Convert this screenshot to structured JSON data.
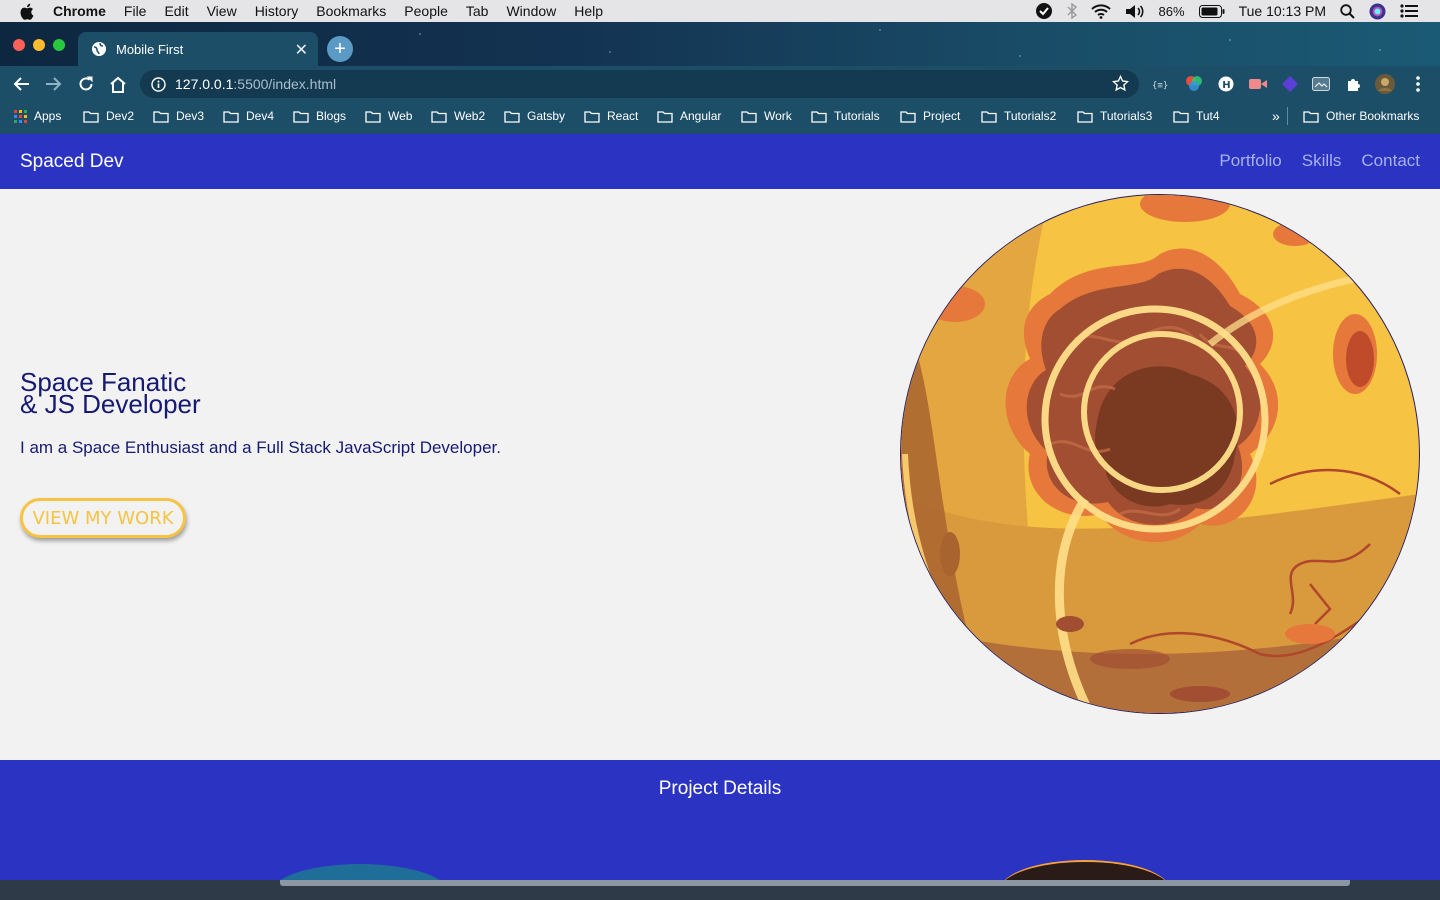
{
  "menubar": {
    "app": "Chrome",
    "items": [
      "File",
      "Edit",
      "View",
      "History",
      "Bookmarks",
      "People",
      "Tab",
      "Window",
      "Help"
    ],
    "battery": "86%",
    "clock": "Tue 10:13 PM"
  },
  "browser": {
    "tab_title": "Mobile First",
    "url_host": "127.0.0.1",
    "url_path": ":5500/index.html",
    "bookmarks": [
      "Apps",
      "Dev2",
      "Dev3",
      "Dev4",
      "Blogs",
      "Web",
      "Web2",
      "Gatsby",
      "React",
      "Angular",
      "Work",
      "Tutorials",
      "Project",
      "Tutorials2",
      "Tutorials3",
      "Tut4"
    ],
    "overflow": "»",
    "other_bookmarks": "Other Bookmarks"
  },
  "site": {
    "brand": "Spaced Dev",
    "nav": [
      "Portfolio",
      "Skills",
      "Contact"
    ],
    "hero": {
      "title_line1": "Space Fanatic",
      "title_line2": "& JS Developer",
      "subtitle": "I am a Space Enthusiast and a Full Stack JavaScript Developer.",
      "cta": "VIEW MY WORK"
    },
    "projects_title": "Project Details"
  },
  "colors": {
    "navbar": "#2a33c2",
    "heading": "#161a72",
    "accent": "#f6c343"
  }
}
